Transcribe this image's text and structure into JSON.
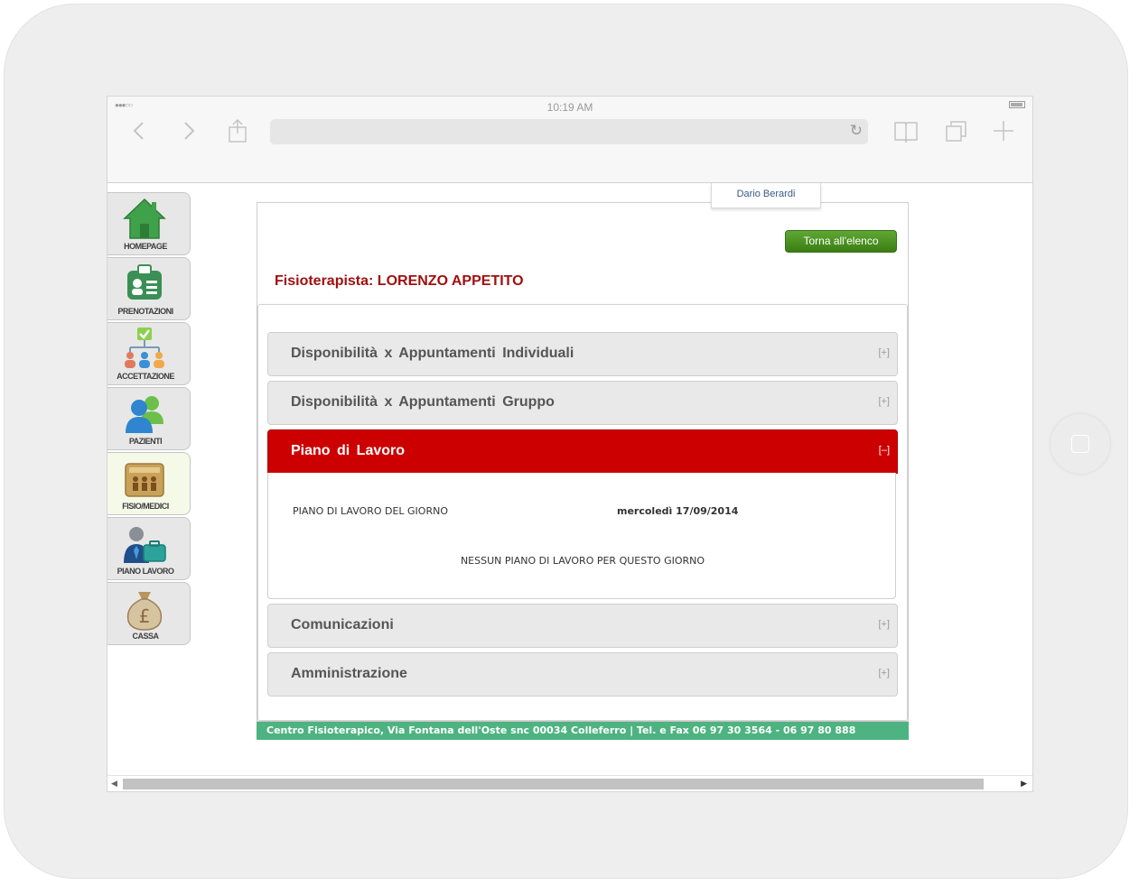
{
  "status_bar": {
    "signal": "●●●○○",
    "time": "10:19 AM"
  },
  "sidebar": {
    "items": [
      {
        "label": "HOMEPAGE",
        "icon": "home-icon"
      },
      {
        "label": "PRENOTAZIONI",
        "icon": "id-card-icon"
      },
      {
        "label": "ACCETTAZIONE",
        "icon": "org-chart-icon"
      },
      {
        "label": "PAZIENTI",
        "icon": "people-icon"
      },
      {
        "label": "FISIO/MEDICI",
        "icon": "staff-board-icon",
        "active": true
      },
      {
        "label": "PIANO LAVORO",
        "icon": "worker-briefcase-icon"
      },
      {
        "label": "CASSA",
        "icon": "money-bag-icon"
      }
    ]
  },
  "user": {
    "name": "Dario Berardi"
  },
  "actions": {
    "back_label": "Torna all'elenco"
  },
  "page": {
    "title": "Fisioterapista: LORENZO APPETITO"
  },
  "accordion": {
    "sections": [
      {
        "title": "Disponibilità x Appuntamenti Individuali",
        "toggle": "[+]"
      },
      {
        "title": "Disponibilità x Appuntamenti Gruppo",
        "toggle": "[+]"
      },
      {
        "title": "Piano di Lavoro",
        "toggle": "[–]",
        "open": true
      },
      {
        "title": "Comunicazioni",
        "toggle": "[+]"
      },
      {
        "title": "Amministrazione",
        "toggle": "[+]"
      }
    ],
    "open_body": {
      "label": "PIANO DI LAVORO DEL GIORNO",
      "date": "mercoledì 17/09/2014",
      "empty_message": "NESSUN PIANO DI LAVORO PER QUESTO GIORNO"
    }
  },
  "footer": {
    "text": "Centro Fisioterapico, Via Fontana dell'Oste snc 00034 Colleferro | Tel. e Fax 06 97 30 3564 - 06 97 80 888"
  },
  "colors": {
    "accent_red": "#cc0000",
    "title_red": "#a01010",
    "button_green": "#4a8f22",
    "footer_green": "#4db380"
  }
}
